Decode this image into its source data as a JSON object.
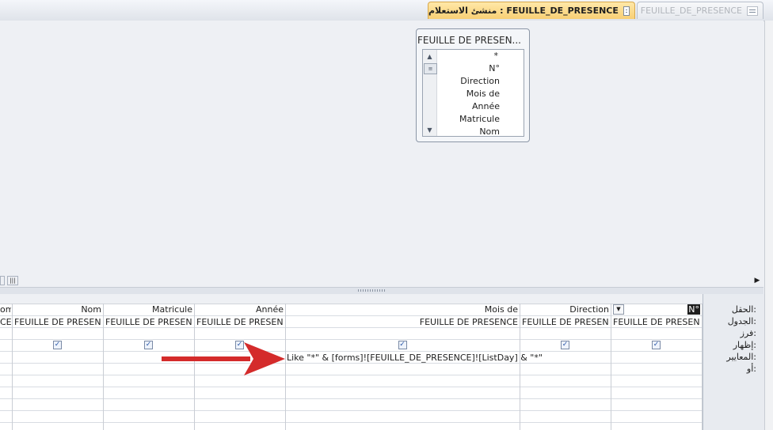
{
  "tabs": {
    "active_title": "منشئ الاستعلام : FEUILLE_DE_PRESENCE",
    "inactive_title": "FEUILLE_DE_PRESENCE",
    "active_icon": "query-icon",
    "inactive_icon": "table-icon"
  },
  "field_list": {
    "title": "FEUILLE DE PRESEN...",
    "items": [
      "*",
      "N°",
      "Direction",
      "Mois de",
      "Année",
      "Matricule",
      "Nom"
    ]
  },
  "row_labels": {
    "field": "الحقل:",
    "table": "الجدول:",
    "sort": "فرز:",
    "show": "إظهار:",
    "criteria": "المعايير:",
    "or": "أو:"
  },
  "columns": [
    {
      "field": "N°",
      "table": "FEUILLE DE PRESENCE",
      "show": true
    },
    {
      "field": "Direction",
      "table": "FEUILLE DE PRESENCE",
      "show": true
    },
    {
      "field": "Mois de",
      "table": "FEUILLE DE PRESENCE",
      "show": true
    },
    {
      "field": "Année",
      "table": "FEUILLE DE PRESENCE",
      "show": true
    },
    {
      "field": "Matricule",
      "table": "FEUILLE DE PRESENCE",
      "show": true
    },
    {
      "field": "Nom",
      "table": "FEUILLE DE PRESENCE",
      "show": true
    },
    {
      "field": "om",
      "table": "CE",
      "show": false
    }
  ],
  "criteria_text": "Like \"*\" & [forms]![FEUILLE_DE_PRESENCE]![ListDay] & \"*\"",
  "colors": {
    "arrow": "#d42b2b",
    "active_tab": "#f8cf74"
  }
}
